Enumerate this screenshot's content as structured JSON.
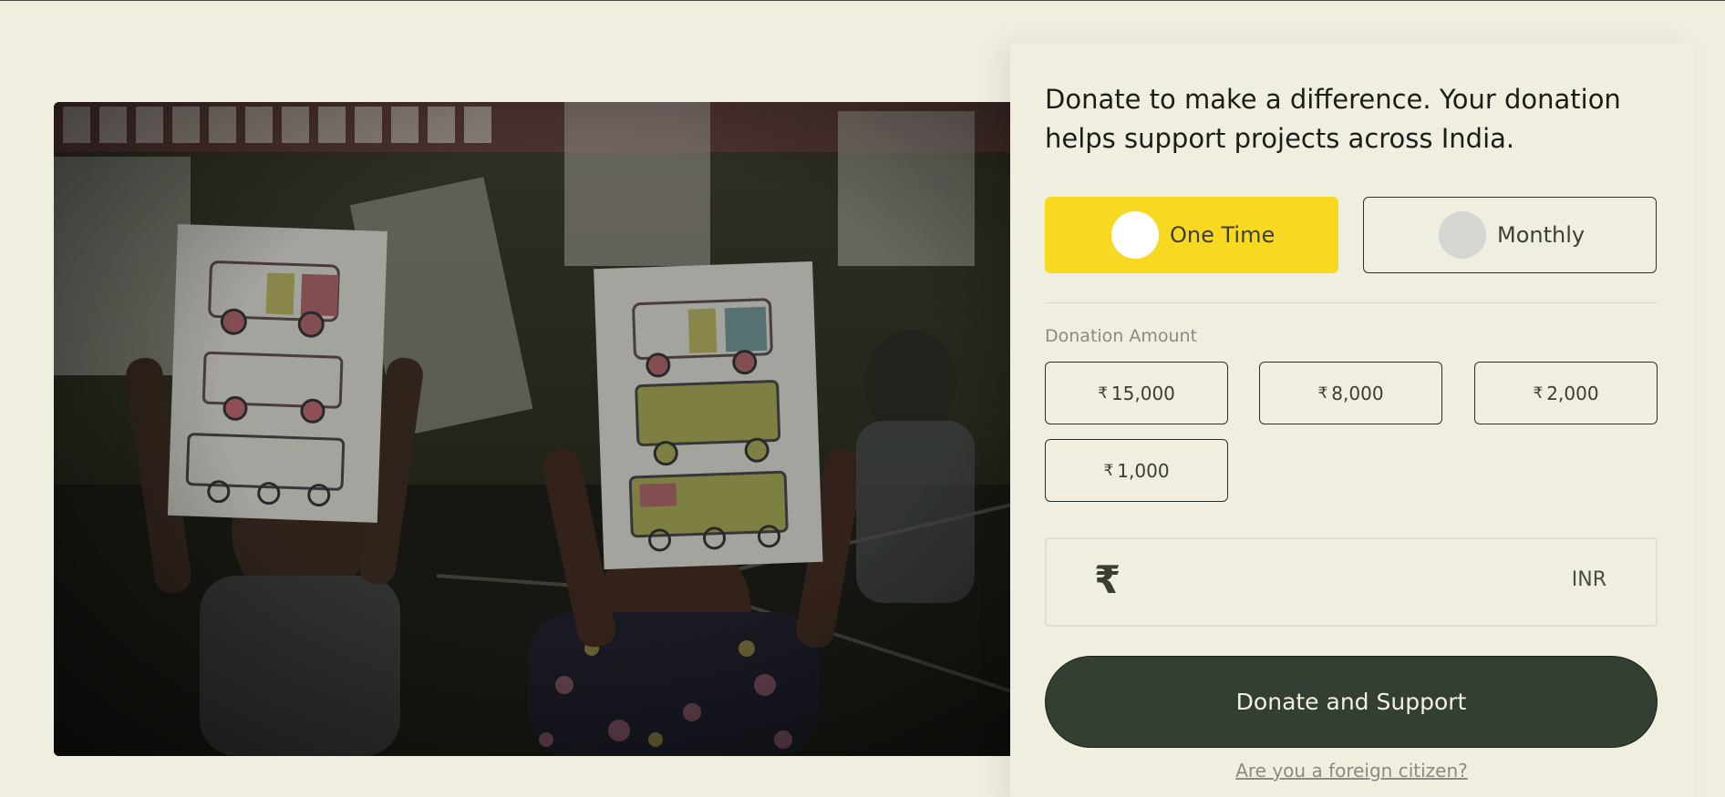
{
  "hero": {
    "image_alt": "Children holding up drawings of vehicles"
  },
  "donate": {
    "headline": "Donate to make a difference. Your donation helps support projects across India.",
    "frequency": {
      "options": [
        "One Time",
        "Monthly"
      ],
      "selected": "One Time"
    },
    "amount_label": "Donation Amount",
    "amounts": [
      {
        "symbol": "₹",
        "value": "15,000"
      },
      {
        "symbol": "₹",
        "value": "8,000"
      },
      {
        "symbol": "₹",
        "value": "2,000"
      },
      {
        "symbol": "₹",
        "value": "1,000"
      }
    ],
    "custom_amount": {
      "currency_symbol": "₹",
      "currency_code": "INR",
      "value": ""
    },
    "submit_label": "Donate and Support",
    "foreign_link": "Are you a foreign citizen?"
  },
  "colors": {
    "background": "#f0efdf",
    "selected_option": "#f8d922",
    "primary_button": "#343f33"
  }
}
